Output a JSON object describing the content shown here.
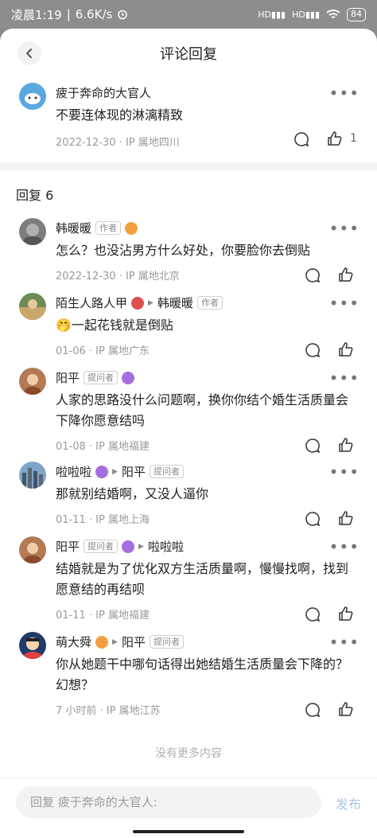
{
  "status_bar": {
    "time": "凌晨1:19",
    "speed": "6.6K/s",
    "battery": "84"
  },
  "header": {
    "title": "评论回复"
  },
  "root_comment": {
    "author": "疲于奔命的大官人",
    "text": "不要连体现的淋漓精致",
    "meta": "2022-12-30 · IP 属地四川",
    "likes": "1"
  },
  "replies_section": {
    "title": "回复 6"
  },
  "replies": [
    {
      "author": "韩暖暖",
      "author_tag": "作者",
      "text": "怎么？也没沾男方什么好处，你要脸你去倒贴",
      "meta": "2022-12-30 · IP 属地北京"
    },
    {
      "author": "陌生人路人甲",
      "reply_to": "韩暖暖",
      "reply_to_tag": "作者",
      "emoji": "🤭",
      "text": "一起花钱就是倒贴",
      "meta": "01-06 · IP 属地广东"
    },
    {
      "author": "阳平",
      "author_tag": "提问者",
      "text": "人家的思路没什么问题啊，换你你结个婚生活质量会下降你愿意结吗",
      "meta": "01-08 · IP 属地福建"
    },
    {
      "author": "啦啦啦",
      "reply_to": "阳平",
      "reply_to_tag": "提问者",
      "text": "那就别结婚啊，又没人逼你",
      "meta": "01-11 · IP 属地上海"
    },
    {
      "author": "阳平",
      "author_tag": "提问者",
      "reply_to": "啦啦啦",
      "text": "结婚就是为了优化双方生活质量啊，慢慢找啊，找到愿意结的再结呗",
      "meta": "01-11 · IP 属地福建"
    },
    {
      "author": "萌大舜",
      "reply_to": "阳平",
      "reply_to_tag": "提问者",
      "text": "你从她题干中哪句话得出她结婚生活质量会下降的？幻想？",
      "meta": "7 小时前 · IP 属地江苏"
    }
  ],
  "footer": {
    "no_more": "没有更多内容"
  },
  "reply_bar": {
    "placeholder": "回复 疲于奔命的大官人:",
    "send_label": "发布"
  },
  "colors": {
    "badge_orange": "#f0a040",
    "badge_purple": "#a56ee0",
    "badge_red": "#e05050",
    "send_disabled": "#a7c4ea"
  }
}
